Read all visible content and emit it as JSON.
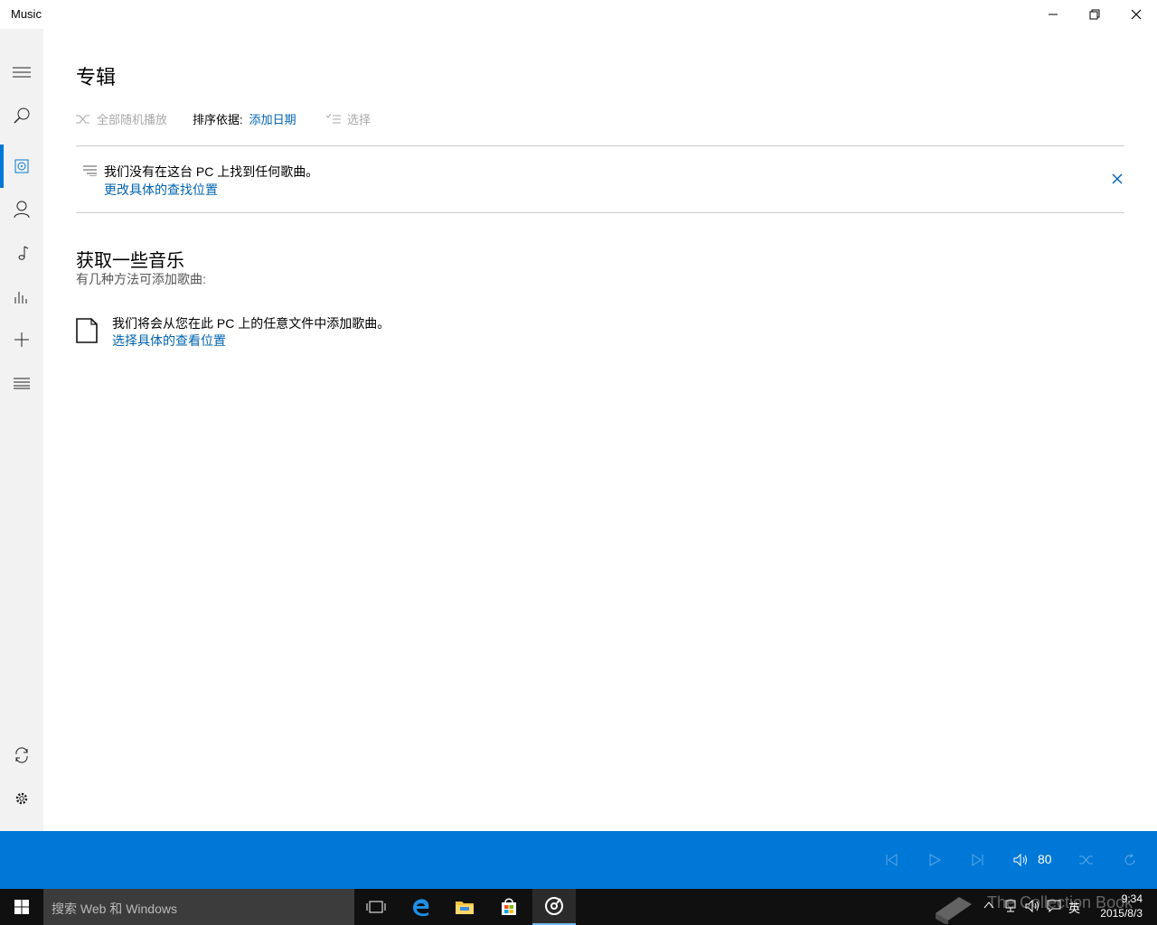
{
  "window": {
    "title": "Music"
  },
  "page": {
    "title": "专辑"
  },
  "commands": {
    "shuffle_all": "全部随机播放",
    "sort_label": "排序依据:",
    "sort_value": "添加日期",
    "select": "选择"
  },
  "notice": {
    "message": "我们没有在这台 PC 上找到任何歌曲。",
    "link": "更改具体的查找位置"
  },
  "get_music": {
    "title": "获取一些音乐",
    "subtitle": "有几种方法可添加歌曲:",
    "option_text": "我们将会从您在此 PC 上的任意文件中添加歌曲。",
    "option_link": "选择具体的查看位置"
  },
  "player": {
    "volume": "80"
  },
  "taskbar": {
    "search_placeholder": "搜索 Web 和 Windows",
    "ime": "英",
    "time": "9:34",
    "date": "2015/8/3",
    "watermark": "The Collection Book"
  },
  "colors": {
    "accent": "#0078d7",
    "link": "#0063b1",
    "rail": "#f2f2f2",
    "taskbar": "#101010"
  }
}
